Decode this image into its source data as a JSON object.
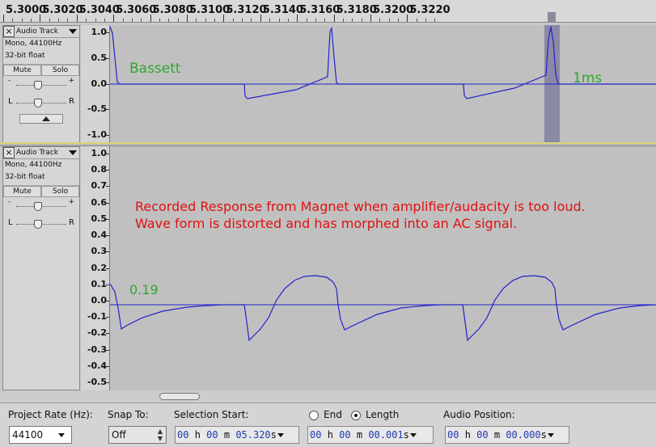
{
  "ruler": {
    "labels": [
      "5.3000",
      "5.3020",
      "5.3040",
      "5.3060",
      "5.3080",
      "5.3100",
      "5.3120",
      "5.3140",
      "5.3160",
      "5.3180",
      "5.3200",
      "5.3220"
    ]
  },
  "tracks": [
    {
      "name": "Audio Track",
      "format": "Mono, 44100Hz",
      "depth": "32-bit float",
      "mute": "Mute",
      "solo": "Solo",
      "gain_minus": "-",
      "gain_plus": "+",
      "pan_left": "L",
      "pan_right": "R",
      "scale": [
        "1.0",
        "0.5",
        "0.0",
        "-0.5",
        "-1.0"
      ],
      "annotations": {
        "left": "Bassett",
        "right": "1ms"
      }
    },
    {
      "name": "Audio Track",
      "format": "Mono, 44100Hz",
      "depth": "32-bit float",
      "mute": "Mute",
      "solo": "Solo",
      "gain_minus": "-",
      "gain_plus": "+",
      "pan_left": "L",
      "pan_right": "R",
      "scale": [
        "1.0",
        "0.8",
        "0.7",
        "0.6",
        "0.5",
        "0.4",
        "0.3",
        "0.2",
        "0.1",
        "0.0",
        "-0.1",
        "-0.2",
        "-0.3",
        "-0.4",
        "-0.5"
      ],
      "annotations": {
        "note_line1": "Recorded Response from Magnet when amplifier/audacity is too loud.",
        "note_line2": "Wave form is distorted and has morphed into an AC signal.",
        "level": "0.19"
      }
    }
  ],
  "toolbar": {
    "project_rate_label": "Project Rate (Hz):",
    "project_rate_value": "44100",
    "snap_to_label": "Snap To:",
    "snap_to_value": "Off",
    "selection_start_label": "Selection Start:",
    "end_label": "End",
    "length_label": "Length",
    "audio_position_label": "Audio Position:",
    "selection_start": {
      "h": "00",
      "m": "00",
      "s": "05.320"
    },
    "length": {
      "h": "00",
      "m": "00",
      "s": "00.001"
    },
    "audio_position": {
      "h": "00",
      "m": "00",
      "s": "00.000"
    },
    "unit_h": "h",
    "unit_m": "m",
    "unit_s": "s"
  },
  "colors": {
    "waveform": "#2222cc",
    "annotation_green": "#2ea82e",
    "annotation_red": "#e01010",
    "selection": "#8a8aa6"
  }
}
